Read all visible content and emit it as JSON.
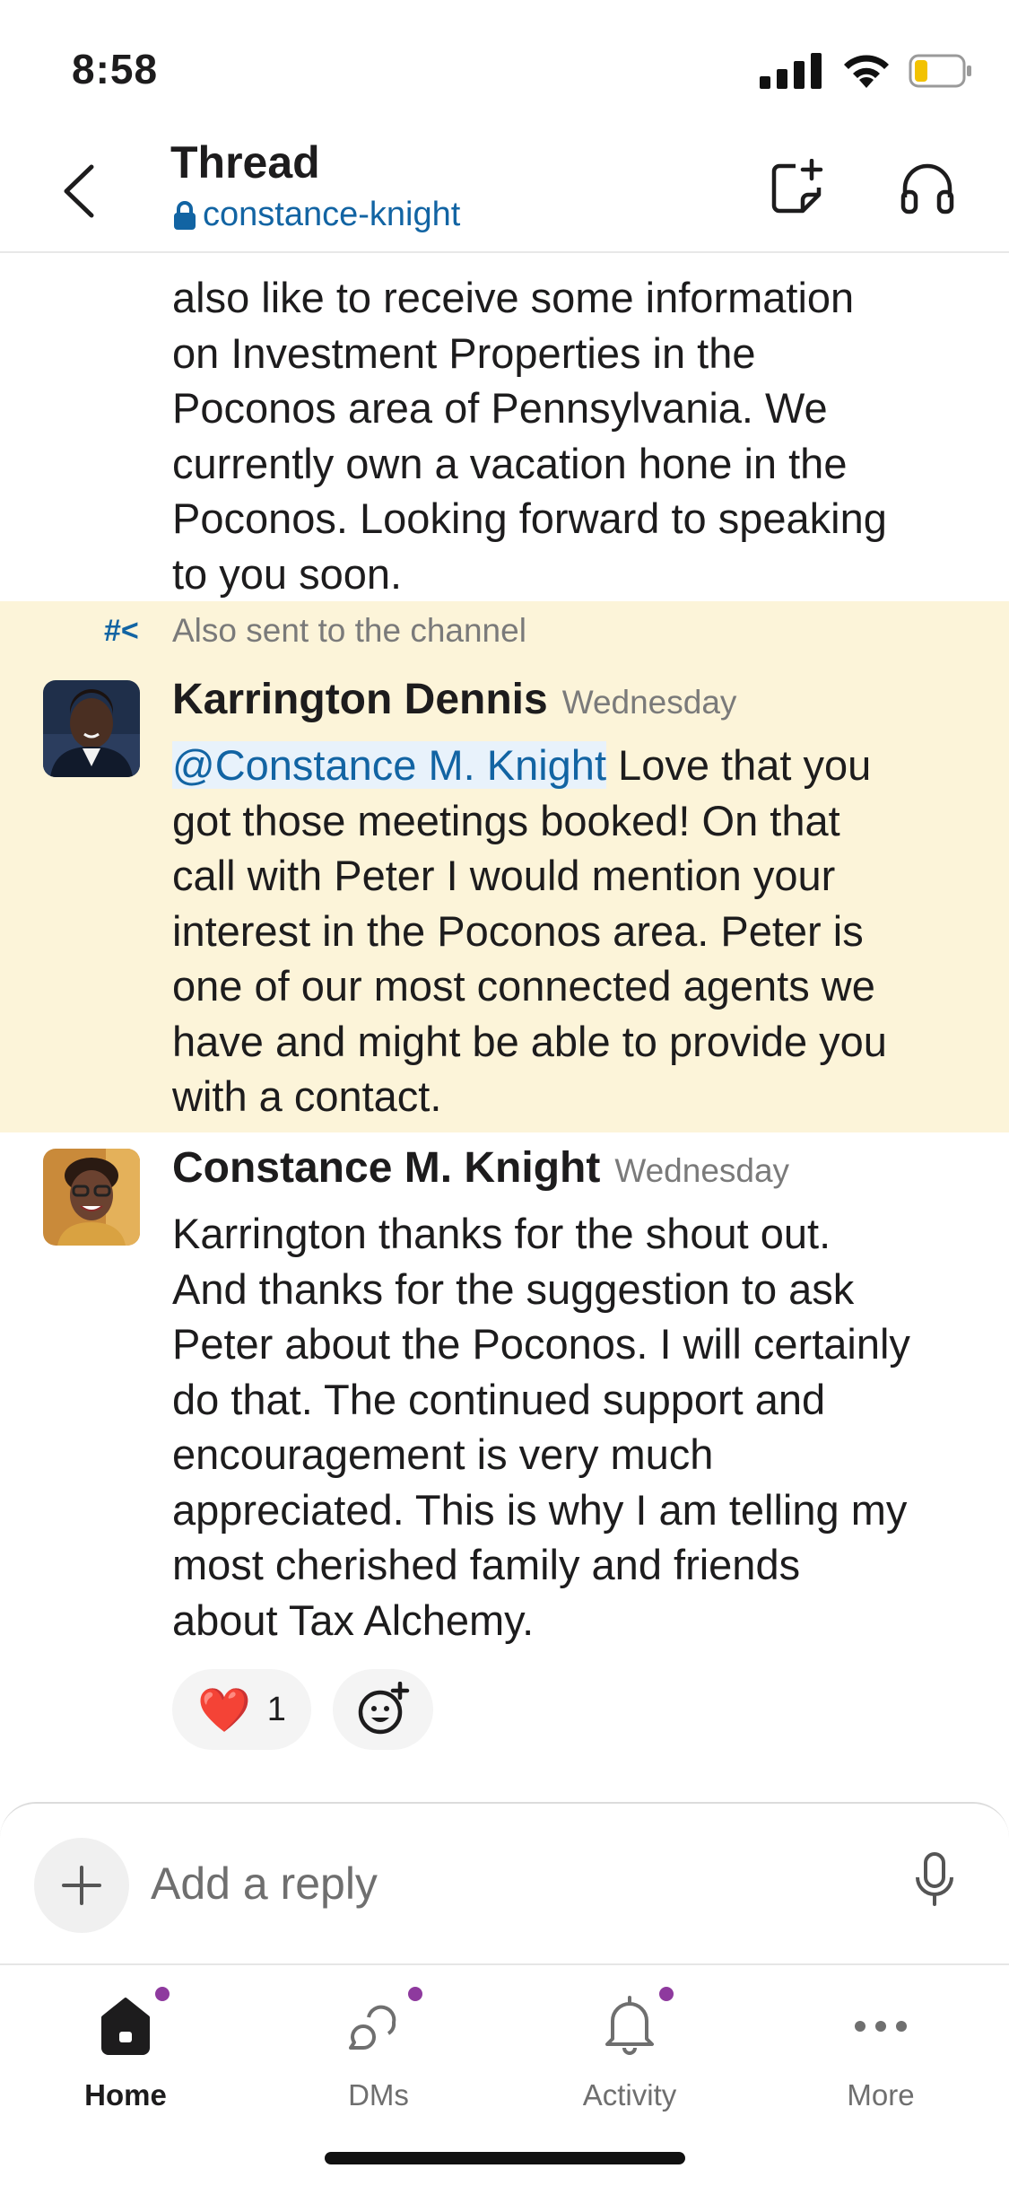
{
  "status_bar": {
    "time": "8:58"
  },
  "header": {
    "title": "Thread",
    "channel": "constance-knight"
  },
  "previous_message": {
    "lines": [
      "also like to receive some information",
      "on Investment Properties in the",
      "Poconos area of Pennsylvania. We",
      "currently own a vacation hone in the",
      "Poconos. Looking forward to speaking",
      "to you soon."
    ]
  },
  "messages": [
    {
      "also_sent": "Also sent to the channel",
      "author": "Karrington Dennis",
      "time": "Wednesday",
      "mention": "@Constance M. Knight",
      "text_lines": [
        " Love that you",
        "got those meetings booked! On that",
        "call with Peter I would mention your",
        "interest in the Poconos area. Peter is",
        "one of our most connected agents we",
        "have and might be able to provide you",
        "with a contact."
      ]
    },
    {
      "author": "Constance M. Knight",
      "time": "Wednesday",
      "text_lines": [
        "Karrington thanks for the shout out.",
        "And thanks for the suggestion to ask",
        "Peter about the Poconos. I will certainly",
        "do that. The continued support and",
        "encouragement is very much",
        "appreciated. This is why I am telling my",
        "most cherished family and friends",
        "about Tax Alchemy."
      ],
      "reactions": [
        {
          "emoji": "❤️",
          "count": "1"
        }
      ]
    }
  ],
  "composer": {
    "placeholder": "Add a reply"
  },
  "tabs": [
    {
      "label": "Home",
      "active": true
    },
    {
      "label": "DMs"
    },
    {
      "label": "Activity"
    },
    {
      "label": "More"
    }
  ],
  "colors": {
    "link": "#1264a3",
    "highlight": "#fcf4d9",
    "badge": "#8e3a9e"
  }
}
